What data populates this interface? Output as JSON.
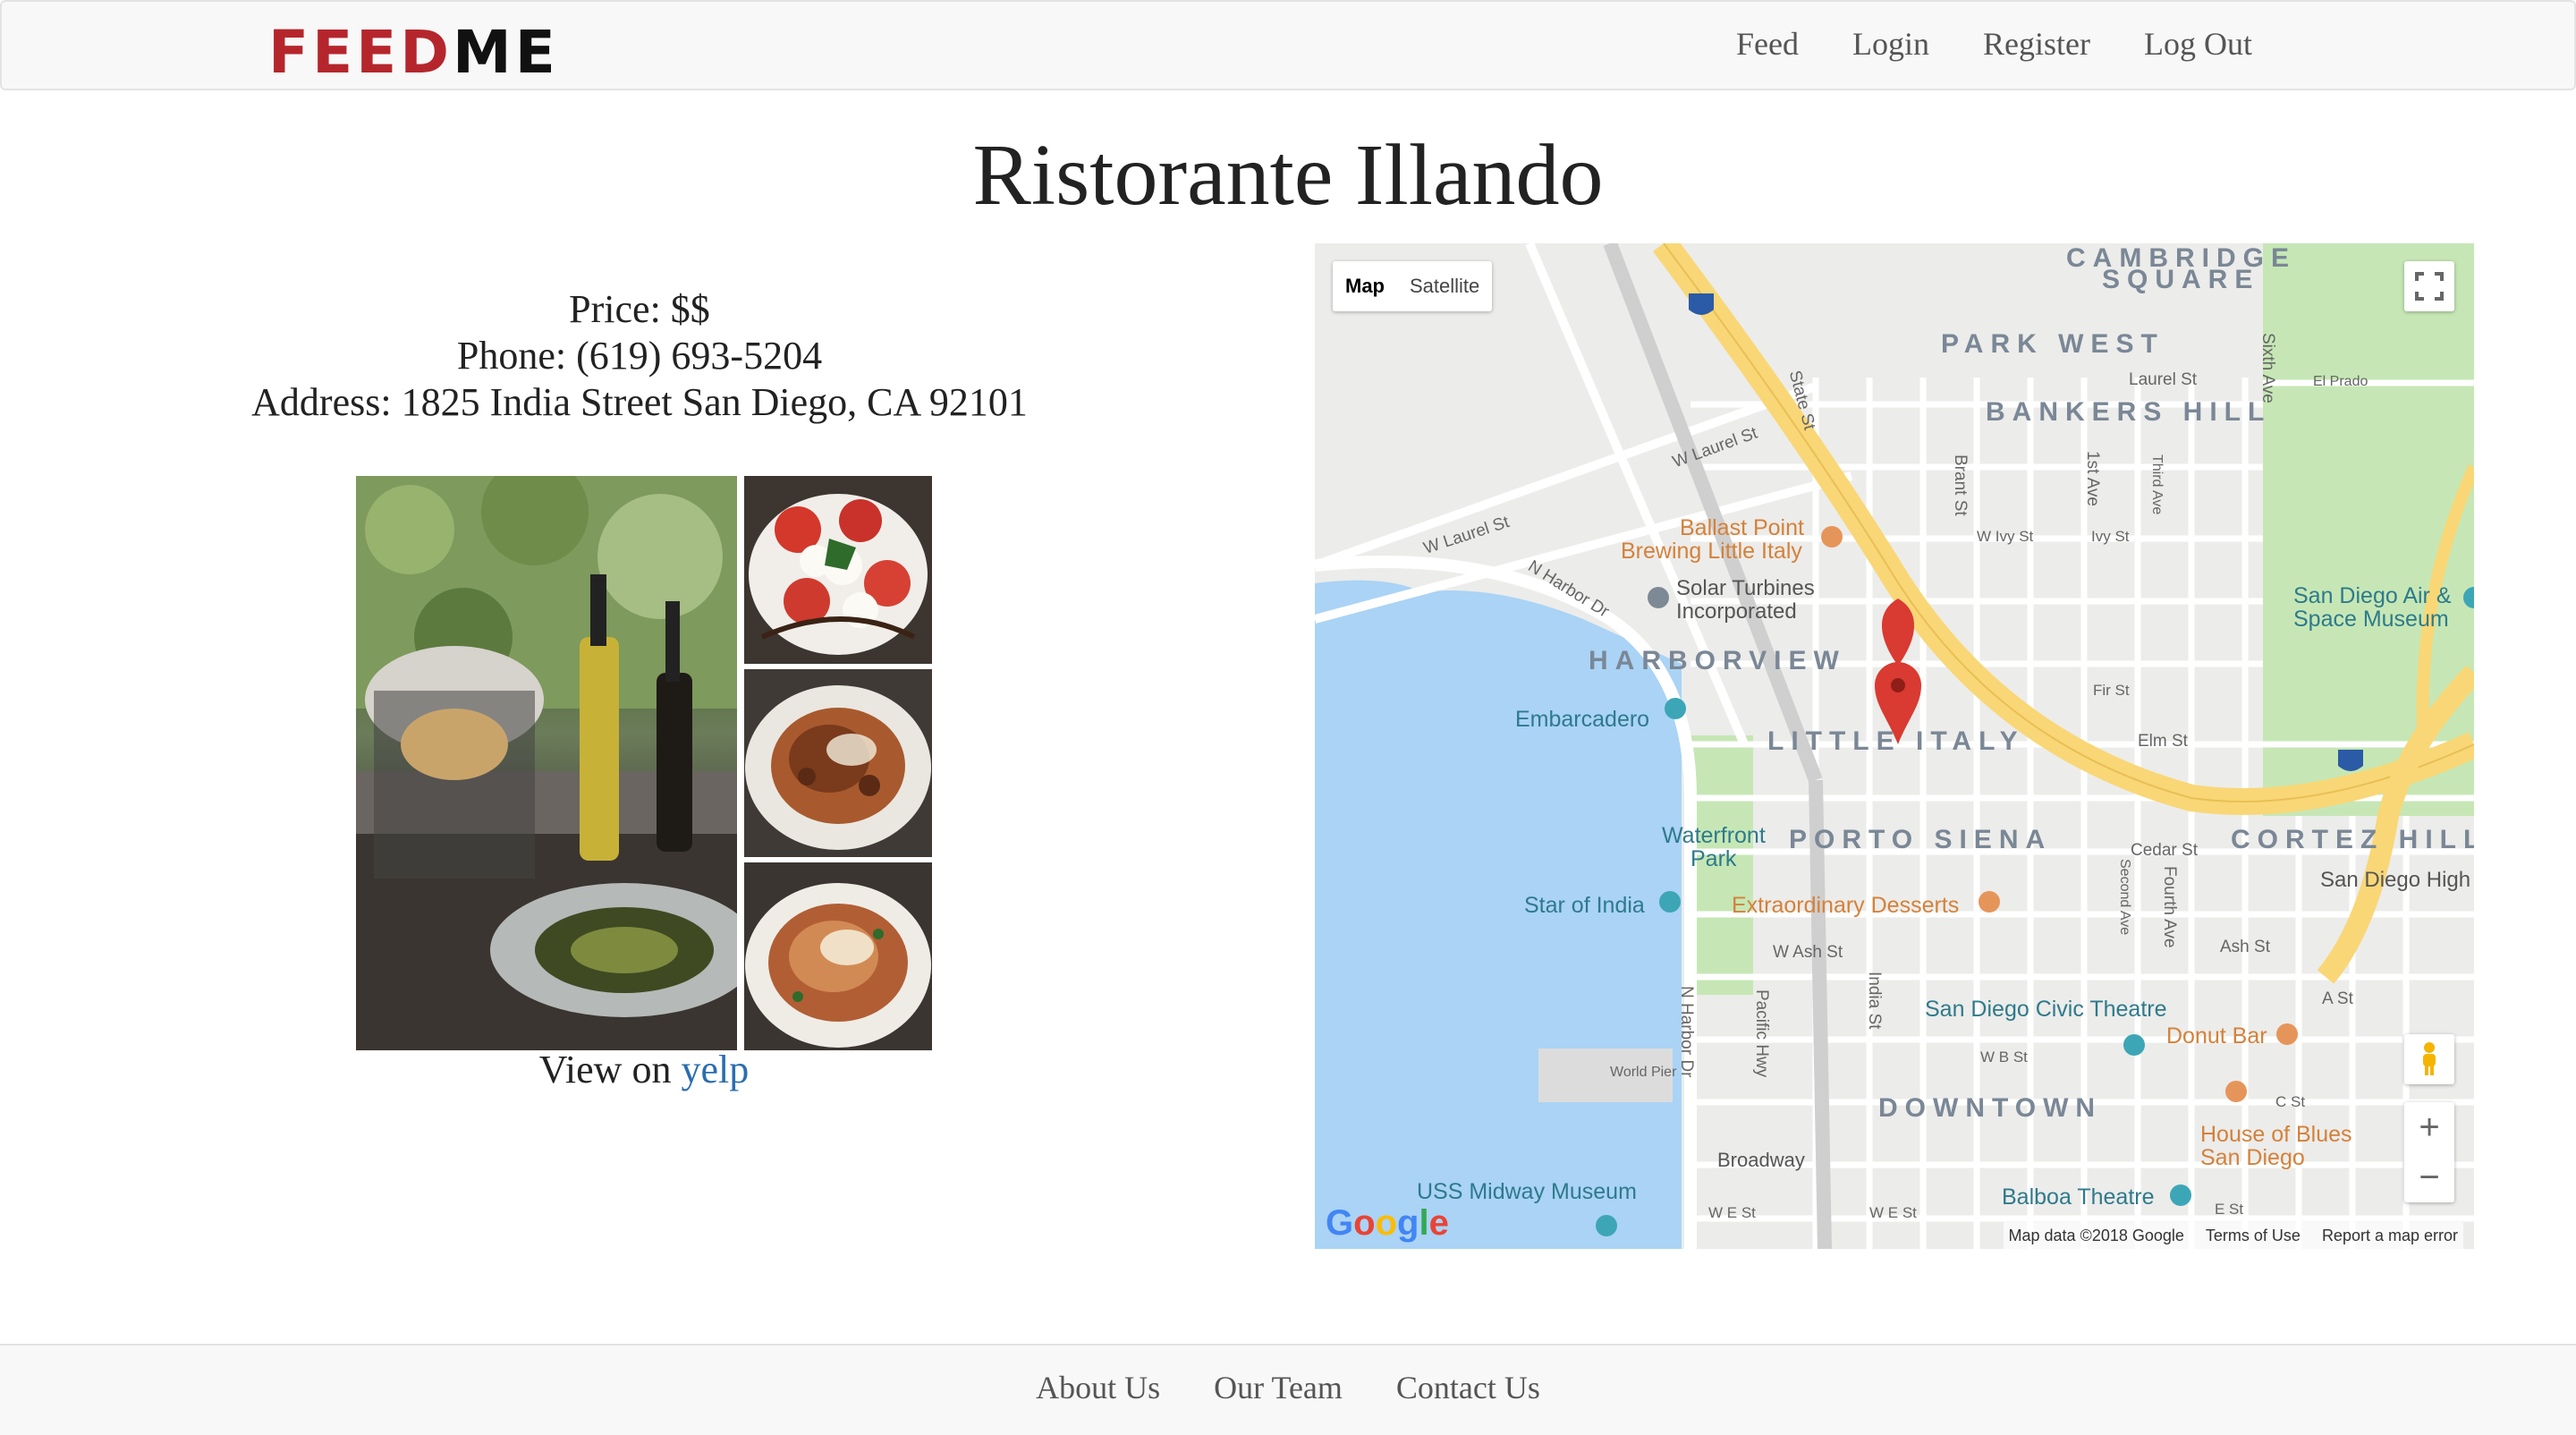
{
  "navbar": {
    "logo": {
      "left": "FEED",
      "right": "ME"
    },
    "links": [
      "Feed",
      "Login",
      "Register",
      "Log Out"
    ]
  },
  "restaurant": {
    "name": "Ristorante Illando",
    "price": "Price: $$",
    "phone": "Phone: (619) 693-5204",
    "address": "Address: 1825 India Street San Diego, CA 92101",
    "view_on_prefix": "View on",
    "view_on_link": "yelp"
  },
  "map": {
    "type_buttons": [
      "Map",
      "Satellite"
    ],
    "neighborhoods": [
      "CAMBRIDGE",
      "SQUARE",
      "PARK WEST",
      "BANKERS HILL",
      "HARBORVIEW",
      "LITTLE ITALY",
      "PORTO SIENA",
      "CORTEZ HILL",
      "DOWNTOWN"
    ],
    "pois": {
      "ballast": "Ballast Point",
      "ballast2": "Brewing Little Italy",
      "solar": "Solar Turbines",
      "solar2": "Incorporated",
      "embarcadero": "Embarcadero",
      "waterfront": "Waterfront",
      "waterfront2": "Park",
      "star": "Star of India",
      "desserts": "Extraordinary Desserts",
      "civic": "San Diego Civic Theatre",
      "donut": "Donut Bar",
      "house": "House of Blues",
      "house2": "San Diego",
      "balboa": "Balboa Theatre",
      "midway": "USS Midway Museum",
      "air": "San Diego Air &",
      "air2": "Space Museum",
      "high": "San Diego High",
      "broadway": "Broadway",
      "world_pier": "World Pier"
    },
    "streets": [
      "W Laurel St",
      "W Laurel St",
      "N Harbor Dr",
      "Laurel St",
      "Elm St",
      "Fir St",
      "Cedar St",
      "Ash St",
      "W Ash St",
      "A St",
      "W B St",
      "C St",
      "W E St",
      "W E St",
      "E St",
      "State St",
      "Brant St",
      "India St",
      "Pacific Hwy",
      "N Harbor Dr",
      "Fourth Ave",
      "Sixth Ave",
      "1st Ave",
      "El Prado",
      "Ivy St",
      "W Ivy St",
      "Second Ave",
      "Third Ave"
    ],
    "google": [
      "G",
      "o",
      "o",
      "g",
      "l",
      "e"
    ],
    "attribution": [
      "Map data ©2018 Google",
      "Terms of Use",
      "Report a map error"
    ],
    "zoom_in": "+",
    "zoom_out": "−",
    "colors": {
      "water": "#aad3f5",
      "park": "#c6e7b5",
      "highway": "#f9d776",
      "road": "#ffffff",
      "land": "#ececea",
      "marker": "#d93a31"
    }
  },
  "footer": {
    "links": [
      "About Us",
      "Our Team",
      "Contact Us"
    ]
  }
}
